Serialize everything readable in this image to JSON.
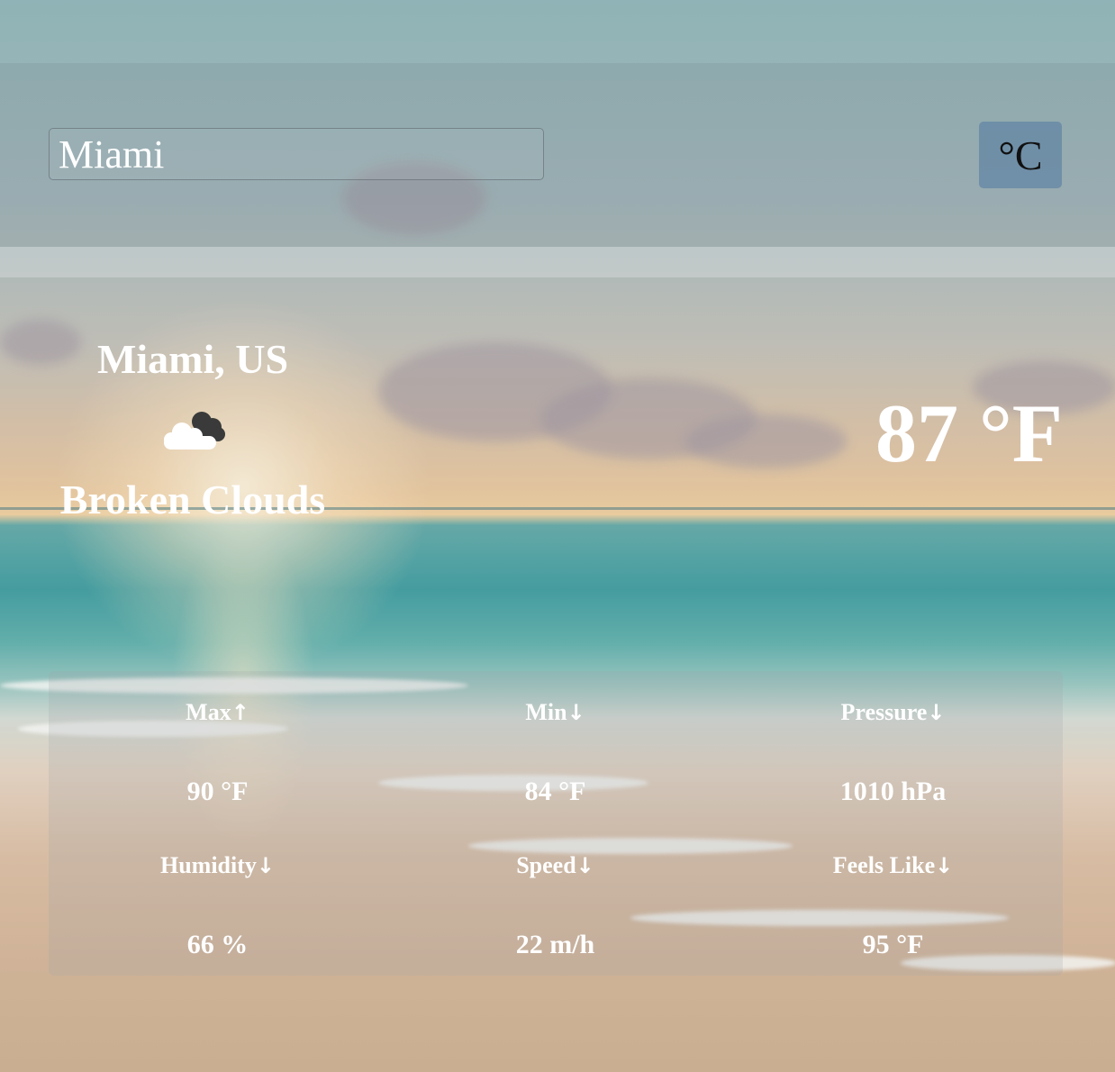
{
  "search": {
    "value": "Miami"
  },
  "unit_toggle": {
    "label": "°C"
  },
  "current": {
    "location": "Miami, US",
    "icon": "broken-clouds-icon",
    "condition": "Broken Clouds",
    "temperature": "87 °F"
  },
  "stats": [
    {
      "label": "Max",
      "arrow": "↑",
      "value": "90 °F"
    },
    {
      "label": "Min",
      "arrow": "↓",
      "value": "84 °F"
    },
    {
      "label": "Pressure",
      "arrow": "↓",
      "value": "1010 hPa"
    },
    {
      "label": "Humidity",
      "arrow": "↓",
      "value": "66 %"
    },
    {
      "label": "Speed",
      "arrow": "↓",
      "value": "22 m/h"
    },
    {
      "label": "Feels Like",
      "arrow": "↓",
      "value": "95 °F"
    }
  ],
  "colors": {
    "unit_button_bg": "#5a7fa6",
    "text": "#ffffff"
  }
}
